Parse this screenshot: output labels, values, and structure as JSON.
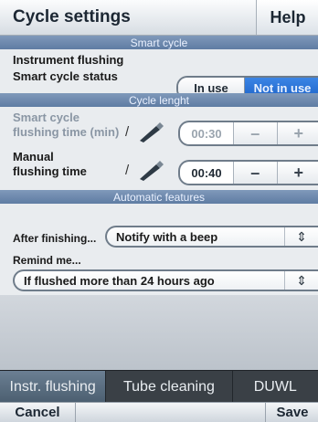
{
  "header": {
    "title": "Cycle settings",
    "help_label": "Help"
  },
  "sections": {
    "smart_cycle": "Smart cycle",
    "cycle_length": "Cycle lenght",
    "automatic": "Automatic features"
  },
  "smart_cycle": {
    "instrument_flushing_label": "Instrument flushing",
    "status_label": "Smart cycle status",
    "status_options": [
      "In use",
      "Not in use"
    ],
    "selected": "Not in use"
  },
  "cycle_length": {
    "smart_label_line1": "Smart cycle",
    "smart_label_line2": "flushing time (min)",
    "smart_value": "00:30",
    "manual_label_line1": "Manual",
    "manual_label_line2": "flushing time",
    "manual_value": "00:40",
    "separator": "/",
    "minus": "–",
    "plus": "+"
  },
  "automatic": {
    "after_label": "After finishing...",
    "after_value": "Notify with a beep",
    "remind_label": "Remind me...",
    "remind_value": "If flushed more than 24 hours ago",
    "dropdown_glyph": "⇕"
  },
  "tabs": [
    "Instr. flushing",
    "Tube cleaning",
    "DUWL"
  ],
  "footer": {
    "cancel_label": "Cancel",
    "save_label": "Save"
  },
  "colors": {
    "section": "#6a85ab",
    "selected": "#2a72d8"
  }
}
